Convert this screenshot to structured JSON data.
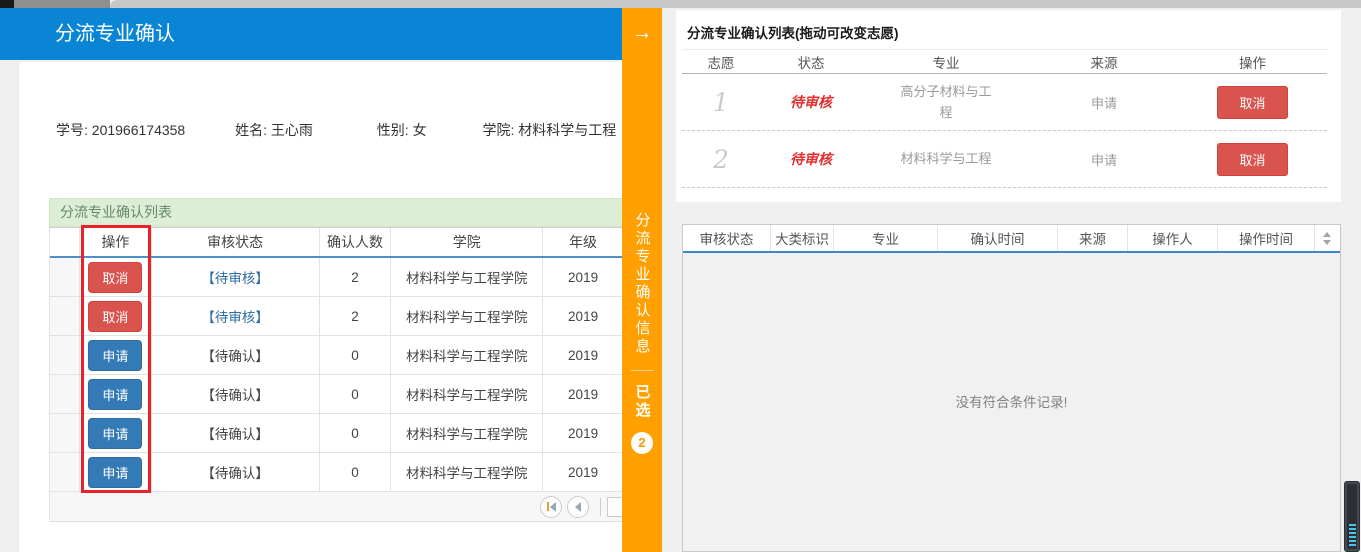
{
  "colors": {
    "accent_blue": "#0a85d6",
    "accent_orange": "#ffa000",
    "danger_red": "#d9534f",
    "primary_blue": "#337ab7",
    "status_red": "#e03232",
    "status_link_blue": "#2e6da4",
    "green_bar_bg": "#ddeed6"
  },
  "icons": {
    "expand_arrow": "→",
    "first_page": "css-bar-and-left-triangle",
    "prev_page": "css-left-triangle",
    "scroll_up": "css-triangle-up",
    "scroll_down": "css-triangle-down"
  },
  "left_panel": {
    "title": "分流专业确认",
    "student_info": [
      {
        "label": "学号:",
        "value": "201966174358"
      },
      {
        "label": "姓名:",
        "value": "王心雨"
      },
      {
        "label": "性别:",
        "value": "女"
      },
      {
        "label": "学院:",
        "value": "材料科学与工程"
      }
    ],
    "list_header": "分流专业确认列表",
    "table": {
      "headers": [
        "操作",
        "审核状态",
        "确认人数",
        "学院",
        "年级"
      ],
      "rows": [
        {
          "action": "取消",
          "action_class": "cancel",
          "status": "【待审核】",
          "status_class": "link",
          "count": "2",
          "college": "材料科学与工程学院",
          "grade": "2019"
        },
        {
          "action": "取消",
          "action_class": "cancel",
          "status": "【待审核】",
          "status_class": "link",
          "count": "2",
          "college": "材料科学与工程学院",
          "grade": "2019"
        },
        {
          "action": "申请",
          "action_class": "apply",
          "status": "【待确认】",
          "status_class": "plain",
          "count": "0",
          "college": "材料科学与工程学院",
          "grade": "2019"
        },
        {
          "action": "申请",
          "action_class": "apply",
          "status": "【待确认】",
          "status_class": "plain",
          "count": "0",
          "college": "材料科学与工程学院",
          "grade": "2019"
        },
        {
          "action": "申请",
          "action_class": "apply",
          "status": "【待确认】",
          "status_class": "plain",
          "count": "0",
          "college": "材料科学与工程学院",
          "grade": "2019"
        },
        {
          "action": "申请",
          "action_class": "apply",
          "status": "【待确认】",
          "status_class": "plain",
          "count": "0",
          "college": "材料科学与工程学院",
          "grade": "2019"
        }
      ]
    }
  },
  "sidebar": {
    "arrow": "→",
    "vertical_title": "分流专业确认信息",
    "selected_label": "已选",
    "selected_count": "2"
  },
  "right_panel": {
    "title": "分流专业确认列表(拖动可改变志愿)",
    "wish_table": {
      "headers": [
        "志愿",
        "状态",
        "专业",
        "来源",
        "操作"
      ],
      "rows": [
        {
          "rank": "1",
          "status": "待审核",
          "major": "高分子材料与工程",
          "source": "申请",
          "action": "取消"
        },
        {
          "rank": "2",
          "status": "待审核",
          "major": "材料科学与工程",
          "source": "申请",
          "action": "取消"
        }
      ]
    },
    "history_table": {
      "headers": [
        "审核状态",
        "大类标识",
        "专业",
        "确认时间",
        "来源",
        "操作人",
        "操作时间"
      ],
      "empty_text": "没有符合条件记录!"
    }
  }
}
